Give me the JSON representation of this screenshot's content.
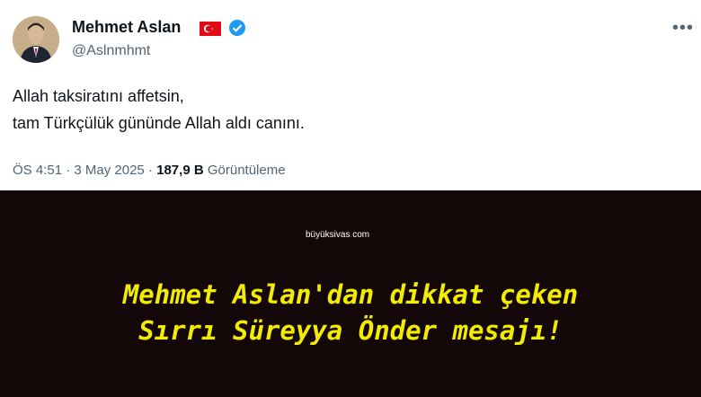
{
  "tweet": {
    "display_name": "Mehmet Aslan",
    "handle": "@Aslnmhmt",
    "flag_icon": "turkish-flag-icon",
    "verified_icon": "verified-badge-icon",
    "more_icon": "more-options-icon",
    "text_line1": "Allah taksiratını affetsin,",
    "text_line2": "tam Türkçülük gününde Allah aldı canını.",
    "time": "ÖS 4:51",
    "separator": "·",
    "date": "3 May 2025",
    "views_count": "187,9 B",
    "views_label": "Görüntüleme"
  },
  "watermark": {
    "site": "büyüksivas",
    "tld": "com"
  },
  "headline": {
    "line1": "Mehmet Aslan'dan dikkat çeken",
    "line2": "Sırrı Süreyya Önder mesajı!"
  },
  "colors": {
    "headline": "#f2ec00",
    "background": "#140708",
    "verified": "#1d9bf0",
    "flag": "#e30a17"
  }
}
